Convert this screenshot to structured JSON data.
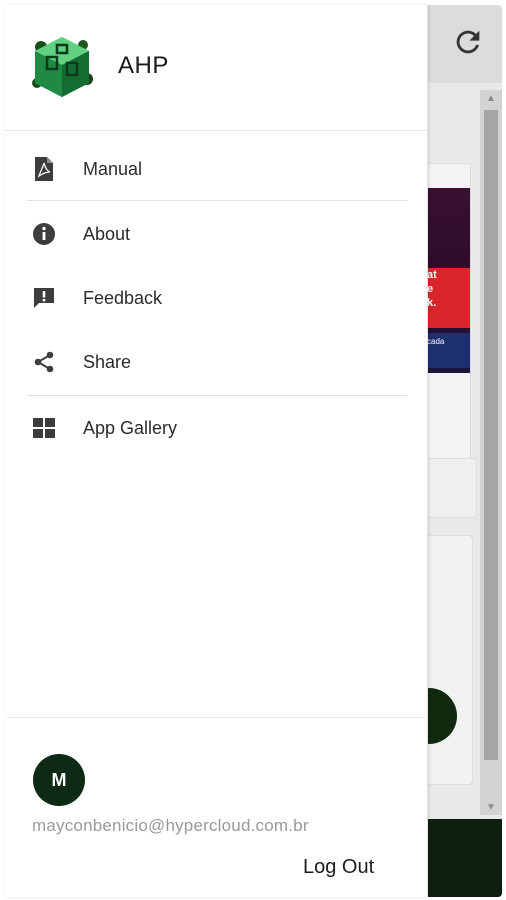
{
  "drawer": {
    "title": "AHP",
    "menu": [
      {
        "label": "Manual",
        "icon": "pdf-file-icon"
      },
      {
        "label": "About",
        "icon": "info-icon"
      },
      {
        "label": "Feedback",
        "icon": "feedback-icon"
      },
      {
        "label": "Share",
        "icon": "share-icon"
      },
      {
        "label": "App Gallery",
        "icon": "grid-icon"
      }
    ],
    "user": {
      "avatar_initial": "M",
      "email": "mayconbenicio@hypercloud.com.br"
    },
    "logout_label": "Log Out"
  },
  "background": {
    "promo_lines": [
      "at",
      "e",
      "k.",
      "cada"
    ]
  },
  "colors": {
    "accent": "#0d2a15",
    "drawer_bg": "#ffffff",
    "icon": "#3d3d3d",
    "email_text": "#9a9a9a"
  }
}
